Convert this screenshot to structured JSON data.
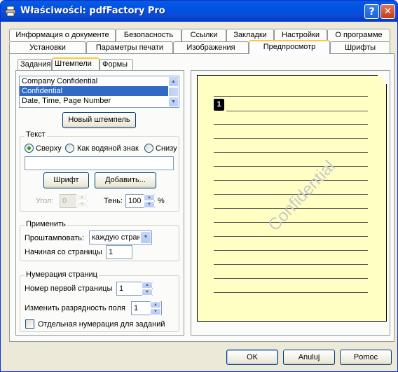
{
  "window": {
    "title": "Właściwości: pdfFactory Pro",
    "help_label": "?",
    "close_label": "✕"
  },
  "tabs_row1": [
    {
      "label": "Информация о документе"
    },
    {
      "label": "Безопасность"
    },
    {
      "label": "Ссылки"
    },
    {
      "label": "Закладки"
    },
    {
      "label": "Настройки"
    },
    {
      "label": "О программе"
    }
  ],
  "tabs_row2": [
    {
      "label": "Установки"
    },
    {
      "label": "Параметры печати"
    },
    {
      "label": "Изображения"
    },
    {
      "label": "Предпросмотр",
      "active": true
    },
    {
      "label": "Шрифты"
    }
  ],
  "subtabs": [
    {
      "label": "Задания"
    },
    {
      "label": "Штемпели",
      "active": true
    },
    {
      "label": "Формы"
    }
  ],
  "stamp_list": {
    "items": [
      "Company Confidential",
      "Confidential",
      "Date, Time, Page Number"
    ],
    "selected_index": 1
  },
  "new_stamp_button": "Новый штемпель",
  "text_group": {
    "title": "Текст",
    "radio_top": "Сверху",
    "radio_watermark": "Как водяной знак",
    "radio_bottom": "Снизу",
    "selected": "top",
    "text_value": "",
    "font_button": "Шрифт",
    "add_button": "Добавить...",
    "angle_label": "Угол:",
    "angle_value": "0",
    "shadow_label": "Тень:",
    "shadow_value": "100",
    "shadow_unit": "%"
  },
  "apply_group": {
    "title": "Применить",
    "stamp_label": "Проштамповать:",
    "stamp_value": "каждую стран",
    "start_label": "Начиная со страницы",
    "start_value": "1"
  },
  "numbering_group": {
    "title": "Нумерация страниц",
    "first_page_label": "Номер первой страницы",
    "first_page_value": "1",
    "digits_label": "Изменить разрядность поля",
    "digits_value": "1",
    "separate_label": "Отдельная нумерация для заданий",
    "separate_checked": false
  },
  "preview": {
    "page_number": "1",
    "watermark_text": "Confidential"
  },
  "footer": {
    "ok": "OK",
    "cancel": "Anuluj",
    "help": "Pomoc"
  },
  "colors": {
    "titlebar": "#0054e3",
    "face": "#ece9d8",
    "paper": "#ffffc4",
    "selection": "#316ac5",
    "active_tab_accent": "#ffc83c"
  }
}
